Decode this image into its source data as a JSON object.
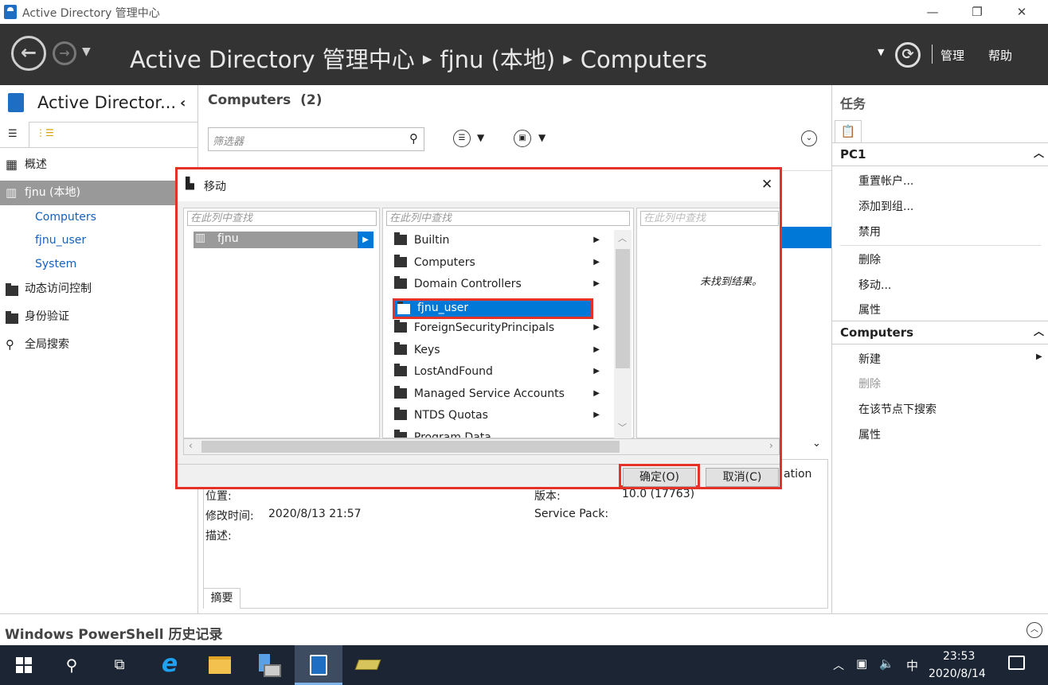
{
  "window": {
    "title": "Active Directory 管理中心",
    "minimize": "—",
    "maximize": "❐",
    "close": "✕"
  },
  "nav": {
    "breadcrumb": [
      "Active Directory 管理中心",
      "fjnu (本地)",
      "Computers"
    ],
    "manage": "管理",
    "help": "帮助"
  },
  "left": {
    "title": "Active Director...",
    "items": [
      {
        "label": "概述"
      },
      {
        "label": "fjnu (本地)"
      },
      {
        "label": "Computers"
      },
      {
        "label": "fjnu_user"
      },
      {
        "label": "System"
      },
      {
        "label": "动态访问控制"
      },
      {
        "label": "身份验证"
      },
      {
        "label": "全局搜索"
      }
    ]
  },
  "center": {
    "heading": "Computers  (2)",
    "filter_placeholder": "筛选器",
    "details": {
      "location_label": "位置:",
      "modified_label": "修改时间:",
      "modified_value": "2020/8/13 21:57",
      "desc_label": "描述:",
      "version_label": "版本:",
      "version_value": "10.0 (17763)",
      "sp_label": "Service Pack:",
      "partial": "ation",
      "tab": "摘要"
    }
  },
  "tasks": {
    "title": "任务",
    "sections": [
      {
        "title": "PC1",
        "items": [
          "重置帐户...",
          "添加到组...",
          "禁用",
          "删除",
          "移动...",
          "属性"
        ]
      },
      {
        "title": "Computers",
        "items": [
          "新建",
          "删除",
          "在该节点下搜索",
          "属性"
        ]
      }
    ]
  },
  "dialog": {
    "title": "移动",
    "search_placeholder": "在此列中查找",
    "col1": [
      "fjnu"
    ],
    "col2": [
      "Builtin",
      "Computers",
      "Domain Controllers",
      "fjnu_user",
      "ForeignSecurityPrincipals",
      "Keys",
      "LostAndFound",
      "Managed Service Accounts",
      "NTDS Quotas",
      "Program Data"
    ],
    "col3_empty": "未找到结果。",
    "ok": "确定(O)",
    "cancel": "取消(C)"
  },
  "powershell": {
    "title": "Windows PowerShell 历史记录"
  },
  "taskbar": {
    "time": "23:53",
    "date": "2020/8/14",
    "ime": "中"
  },
  "colors": {
    "accent": "#0078d7",
    "highlight": "#e53229",
    "nav_bg": "#333333"
  }
}
